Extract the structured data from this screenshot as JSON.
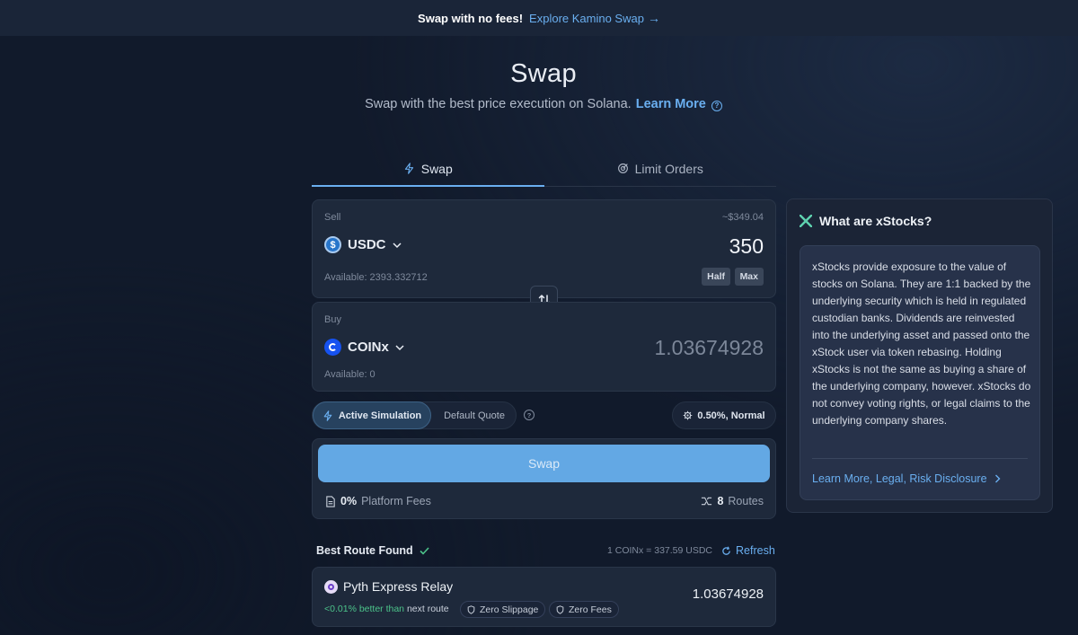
{
  "banner": {
    "text": "Swap with no fees!",
    "link": "Explore Kamino Swap",
    "arrow": "→"
  },
  "header": {
    "title": "Swap",
    "subtitle": "Swap with the best price execution on Solana.",
    "learn_more": "Learn More"
  },
  "tabs": [
    {
      "label": "Swap",
      "icon": "lightning-icon",
      "active": true
    },
    {
      "label": "Limit Orders",
      "icon": "target-icon",
      "active": false
    }
  ],
  "sell": {
    "label": "Sell",
    "usd_value": "~$349.04",
    "token": "USDC",
    "amount": "350",
    "available": "Available: 2393.332712",
    "half_label": "Half",
    "max_label": "Max"
  },
  "buy": {
    "label": "Buy",
    "token": "COINx",
    "amount": "1.03674928",
    "available": "Available: 0"
  },
  "quote": {
    "active_simulation": "Active Simulation",
    "default_quote": "Default Quote",
    "slippage": "0.50%, Normal"
  },
  "action": {
    "swap_label": "Swap",
    "fees_value": "0%",
    "fees_label": "Platform Fees",
    "routes_value": "8",
    "routes_label": "Routes"
  },
  "route": {
    "best_route_label": "Best Route Found",
    "rate": "1 COINx = 337.59 USDC",
    "refresh_label": "Refresh",
    "provider": "Pyth Express Relay",
    "amount": "1.03674928",
    "better_value": "<0.01% better than",
    "better_suffix": "next route",
    "badge_slippage": "Zero Slippage",
    "badge_fees": "Zero Fees"
  },
  "info": {
    "title": "What are xStocks?",
    "body": "xStocks provide exposure to the value of stocks on Solana. They are 1:1 backed by the underlying security which is held in regulated custodian banks. Dividends are reinvested into the underlying asset and passed onto the xStock user via token rebasing. Holding xStocks is not the same as buying a share of the underlying company, however. xStocks do not convey voting rights, or legal claims to the underlying company shares.",
    "link": "Learn More, Legal, Risk Disclosure"
  },
  "colors": {
    "accent": "#6aaff0",
    "swap_button": "#63a8e4",
    "positive": "#4cc38a",
    "background": "#111a2b"
  }
}
